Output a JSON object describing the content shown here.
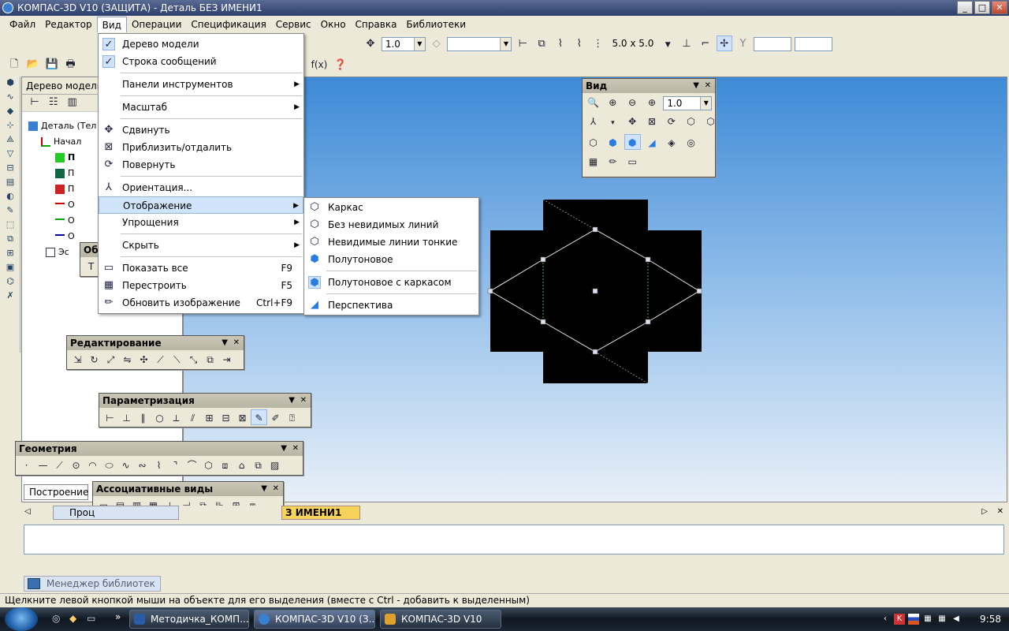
{
  "window": {
    "title": "КОМПАС-3D V10 (ЗАЩИТА) - Деталь БЕЗ ИМЕНИ1",
    "min": "_",
    "max": "□",
    "close": "✕"
  },
  "menubar": {
    "items": [
      "Файл",
      "Редактор",
      "Вид",
      "Операции",
      "Спецификация",
      "Сервис",
      "Окно",
      "Справка",
      "Библиотеки"
    ]
  },
  "toolbar": {
    "step_value": "1.0",
    "grid_value": "5.0 x 5.0",
    "fx_label": "f(x)"
  },
  "tree_panel": {
    "title": "Дерево модели",
    "items": [
      "Деталь (Тел",
      "Начал",
      "П",
      "П",
      "П",
      "О",
      "О",
      "О",
      "Эс"
    ],
    "tab_build": "Построение",
    "tab_process": "Проц"
  },
  "doc_tab": "З ИМЕНИ1",
  "view_menu": {
    "items": [
      {
        "label": "Дерево модели",
        "checked": true
      },
      {
        "label": "Строка сообщений",
        "checked": true
      },
      {
        "label": "Панели инструментов",
        "submenu": true
      },
      {
        "label": "Масштаб",
        "submenu": true
      },
      {
        "label": "Сдвинуть"
      },
      {
        "label": "Приблизить/отдалить"
      },
      {
        "label": "Повернуть"
      },
      {
        "label": "Ориентация..."
      },
      {
        "label": "Отображение",
        "submenu": true,
        "highlighted": true
      },
      {
        "label": "Упрощения",
        "submenu": true
      },
      {
        "label": "Скрыть",
        "submenu": true
      },
      {
        "label": "Показать все",
        "shortcut": "F9"
      },
      {
        "label": "Перестроить",
        "shortcut": "F5"
      },
      {
        "label": "Обновить изображение",
        "shortcut": "Ctrl+F9"
      }
    ]
  },
  "display_submenu": {
    "items": [
      "Каркас",
      "Без невидимых линий",
      "Невидимые линии тонкие",
      "Полутоновое",
      "Полутоновое с каркасом",
      "Перспектива"
    ]
  },
  "view_toolbar": {
    "title": "Вид",
    "zoom_value": "1.0"
  },
  "panels": {
    "editing": "Редактирование",
    "parametrization": "Параметризация",
    "geometry": "Геометрия",
    "assoc_views": "Ассоциативные виды",
    "obj_label": "Об"
  },
  "library_manager": "Менеджер библиотек",
  "status": "Щелкните левой кнопкой мыши на объекте для его выделения (вместе с Ctrl - добавить к выделенным)",
  "taskbar": {
    "tasks": [
      "Методичка_КОМП...",
      "КОМПАС-3D V10 (З...",
      "КОМПАС-3D V10"
    ],
    "clock": "9:58"
  },
  "colors": {
    "accent": "#2b3d6b",
    "menu_highlight": "#cfe3fb",
    "viewport_top": "#3d8ad6"
  }
}
